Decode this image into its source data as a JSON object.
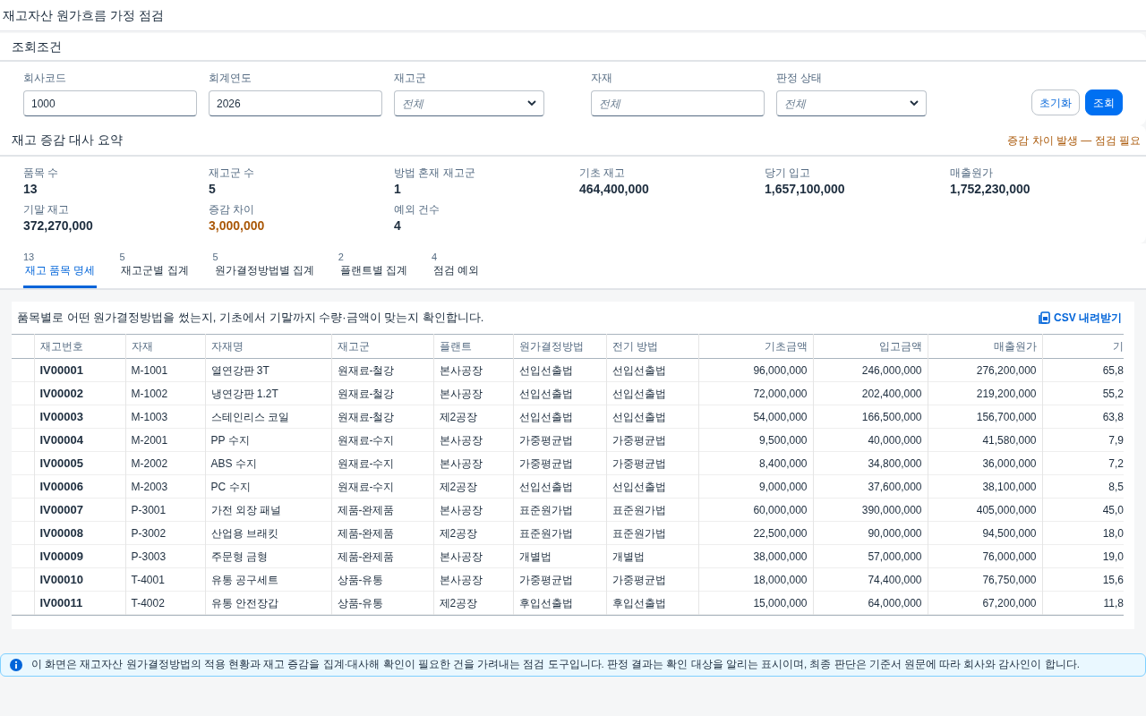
{
  "page_title": "재고자산 원가흐름 가정 점검",
  "filter_panel": {
    "title": "조회조건",
    "fields": [
      {
        "label": "회사코드",
        "kind": "input",
        "value": "1000"
      },
      {
        "label": "회계연도",
        "kind": "input",
        "value": "2026"
      },
      {
        "label": "재고군",
        "kind": "select",
        "placeholder": "전체"
      },
      {
        "label": "자재",
        "kind": "input",
        "placeholder": "전체"
      },
      {
        "label": "판정 상태",
        "kind": "select",
        "placeholder": "전체"
      }
    ],
    "buttons": [
      {
        "label": "초기화",
        "kind": "secondary"
      },
      {
        "label": "조회",
        "kind": "primary"
      }
    ]
  },
  "summary": {
    "title": "재고 증감 대사 요약",
    "status": "증감 차이 발생 — 점검 필요",
    "metrics": [
      {
        "label": "품목 수",
        "value": "13",
        "warning": false
      },
      {
        "label": "재고군 수",
        "value": "5",
        "warning": false
      },
      {
        "label": "방법 혼재 재고군",
        "value": "1",
        "warning": false
      },
      {
        "label": "기초 재고",
        "value": "464,400,000",
        "warning": false
      },
      {
        "label": "당기 입고",
        "value": "1,657,100,000",
        "warning": false
      },
      {
        "label": "매출원가",
        "value": "1,752,230,000",
        "warning": false
      },
      {
        "label": "기말 재고",
        "value": "372,270,000",
        "warning": false
      },
      {
        "label": "증감 차이",
        "value": "3,000,000",
        "warning": true
      },
      {
        "label": "예외 건수",
        "value": "4",
        "warning": false
      }
    ]
  },
  "tabs": [
    {
      "count": "13",
      "label": "재고 품목 명세",
      "selected": true
    },
    {
      "count": "5",
      "label": "재고군별 집계",
      "selected": false
    },
    {
      "count": "5",
      "label": "원가결정방법별 집계",
      "selected": false
    },
    {
      "count": "2",
      "label": "플랜트별 집계",
      "selected": false
    },
    {
      "count": "4",
      "label": "점검 예외",
      "selected": false
    }
  ],
  "table_panel": {
    "description": "품목별로 어떤 원가결정방법을 썼는지, 기초에서 기말까지 수량·금액이 맞는지 확인합니다.",
    "download": "CSV 내려받기",
    "columns": [
      {
        "label": "재고번호",
        "kind": "text"
      },
      {
        "label": "자재",
        "kind": "text"
      },
      {
        "label": "자재명",
        "kind": "text"
      },
      {
        "label": "재고군",
        "kind": "text"
      },
      {
        "label": "플랜트",
        "kind": "text"
      },
      {
        "label": "원가결정방법",
        "kind": "text"
      },
      {
        "label": "전기 방법",
        "kind": "text"
      },
      {
        "label": "기초금액",
        "kind": "amount"
      },
      {
        "label": "입고금액",
        "kind": "amount"
      },
      {
        "label": "매출원가",
        "kind": "amount"
      },
      {
        "label": "기",
        "kind": "amount"
      }
    ],
    "rows": [
      [
        "IV00001",
        "M-1001",
        "열연강판 3T",
        "원재료-철강",
        "본사공장",
        "선입선출법",
        "선입선출법",
        "96,000,000",
        "246,000,000",
        "276,200,000",
        "65,8"
      ],
      [
        "IV00002",
        "M-1002",
        "냉연강판 1.2T",
        "원재료-철강",
        "본사공장",
        "선입선출법",
        "선입선출법",
        "72,000,000",
        "202,400,000",
        "219,200,000",
        "55,2"
      ],
      [
        "IV00003",
        "M-1003",
        "스테인리스 코일",
        "원재료-철강",
        "제2공장",
        "선입선출법",
        "선입선출법",
        "54,000,000",
        "166,500,000",
        "156,700,000",
        "63,8"
      ],
      [
        "IV00004",
        "M-2001",
        "PP 수지",
        "원재료-수지",
        "본사공장",
        "가중평균법",
        "가중평균법",
        "9,500,000",
        "40,000,000",
        "41,580,000",
        "7,9"
      ],
      [
        "IV00005",
        "M-2002",
        "ABS 수지",
        "원재료-수지",
        "본사공장",
        "가중평균법",
        "가중평균법",
        "8,400,000",
        "34,800,000",
        "36,000,000",
        "7,2"
      ],
      [
        "IV00006",
        "M-2003",
        "PC 수지",
        "원재료-수지",
        "제2공장",
        "선입선출법",
        "선입선출법",
        "9,000,000",
        "37,600,000",
        "38,100,000",
        "8,5"
      ],
      [
        "IV00007",
        "P-3001",
        "가전 외장 패널",
        "제품-완제품",
        "본사공장",
        "표준원가법",
        "표준원가법",
        "60,000,000",
        "390,000,000",
        "405,000,000",
        "45,0"
      ],
      [
        "IV00008",
        "P-3002",
        "산업용 브래킷",
        "제품-완제품",
        "제2공장",
        "표준원가법",
        "표준원가법",
        "22,500,000",
        "90,000,000",
        "94,500,000",
        "18,0"
      ],
      [
        "IV00009",
        "P-3003",
        "주문형 금형",
        "제품-완제품",
        "본사공장",
        "개별법",
        "개별법",
        "38,000,000",
        "57,000,000",
        "76,000,000",
        "19,0"
      ],
      [
        "IV00010",
        "T-4001",
        "유통 공구세트",
        "상품-유통",
        "본사공장",
        "가중평균법",
        "가중평균법",
        "18,000,000",
        "74,400,000",
        "76,750,000",
        "15,6"
      ],
      [
        "IV00011",
        "T-4002",
        "유통 안전장갑",
        "상품-유통",
        "제2공장",
        "후입선출법",
        "후입선출법",
        "15,000,000",
        "64,000,000",
        "67,200,000",
        "11,8"
      ]
    ]
  },
  "info_note": "이 화면은 재고자산 원가결정방법의 적용 현황과 재고 증감을 집계·대사해 확인이 필요한 건을 가려내는 점검 도구입니다. 판정 결과는 확인 대상을 알리는 표시이며, 최종 판단은 기준서 원문에 따라 회사와 감사인이 합니다."
}
